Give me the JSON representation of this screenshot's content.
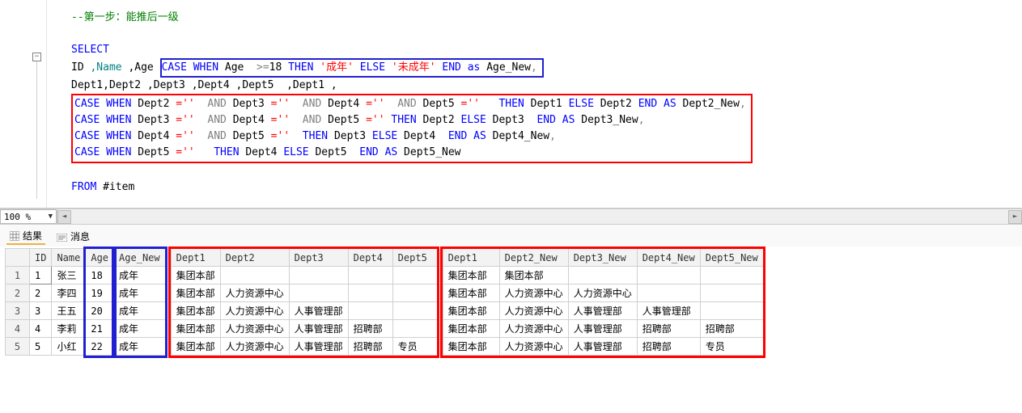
{
  "editor": {
    "comment_line": "--第一步：能推后一级",
    "blank": "",
    "select_kw": "SELECT",
    "line2_pre_id": "ID ",
    "line2_name": ",Name",
    "line2_age": " ,Age ",
    "case_age_case": "CASE",
    "case_age_when": " WHEN",
    "case_age_age": " Age ",
    "case_age_op": " >=",
    "case_age_18": "18 ",
    "case_age_then": "THEN",
    "case_age_adult": " '成年'",
    "case_age_else": " ELSE ",
    "case_age_minor": "'未成年'",
    "case_age_end": " END",
    "case_age_as": " as ",
    "case_age_alias": "Age_New",
    "case_age_comma": ",",
    "line3": "Dept1,Dept2 ,Dept3 ,Dept4 ,Dept5  ,Dept1 ,",
    "d2": {
      "p1": "CASE WHEN ",
      "p2": "Dept2 ",
      "p3": "='' ",
      "p4": " AND ",
      "p5": "Dept3 ",
      "p6": "='' ",
      "p7": " AND ",
      "p8": "Dept4 ",
      "p9": "='' ",
      "p10": " AND ",
      "p11": "Dept5 ",
      "p12": "=''  ",
      "p13": " THEN ",
      "p14": "Dept1 ",
      "p15": "ELSE",
      "p16": " Dept2 ",
      "p17": "END AS",
      "p18": " Dept2_New",
      "p19": ","
    },
    "d3": {
      "p1": "CASE WHEN ",
      "p2": "Dept3 ",
      "p3": "='' ",
      "p4": " AND ",
      "p5": "Dept4 ",
      "p6": "='' ",
      "p7": " AND ",
      "p8": "Dept5 ",
      "p9": "='' ",
      "p10": "THEN ",
      "p11": "Dept2 ",
      "p12": "ELSE",
      "p13": " Dept3  ",
      "p14": "END AS",
      "p15": " Dept3_New",
      "p16": ","
    },
    "d4": {
      "p1": "CASE WHEN ",
      "p2": "Dept4 ",
      "p3": "='' ",
      "p4": " AND ",
      "p5": "Dept5 ",
      "p6": "='' ",
      "p7": " THEN ",
      "p8": "Dept3 ",
      "p9": "ELSE",
      "p10": " Dept4  ",
      "p11": "END AS",
      "p12": " Dept4_New",
      "p13": ","
    },
    "d5": {
      "p1": "CASE WHEN ",
      "p2": "Dept5 ",
      "p3": "=''  ",
      "p4": " THEN ",
      "p5": "Dept4 ",
      "p6": "ELSE",
      "p7": " Dept5  ",
      "p8": "END AS",
      "p9": " Dept5_New"
    },
    "from_kw": "FROM",
    "from_tbl": " #item"
  },
  "zoom": {
    "value": "100 %"
  },
  "tabs": {
    "results": "结果",
    "messages": "消息"
  },
  "grid1": {
    "headers": [
      "ID",
      "Name",
      "Age",
      "Age_New"
    ],
    "rows": [
      {
        "n": "1",
        "ID": "1",
        "Name": "张三",
        "Age": "18",
        "Age_New": "成年"
      },
      {
        "n": "2",
        "ID": "2",
        "Name": "李四",
        "Age": "19",
        "Age_New": "成年"
      },
      {
        "n": "3",
        "ID": "3",
        "Name": "王五",
        "Age": "20",
        "Age_New": "成年"
      },
      {
        "n": "4",
        "ID": "4",
        "Name": "李莉",
        "Age": "21",
        "Age_New": "成年"
      },
      {
        "n": "5",
        "ID": "5",
        "Name": "小红",
        "Age": "22",
        "Age_New": "成年"
      }
    ]
  },
  "grid2": {
    "headers": [
      "Dept1",
      "Dept2",
      "Dept3",
      "Dept4",
      "Dept5"
    ],
    "rows": [
      {
        "Dept1": "集团本部",
        "Dept2": "",
        "Dept3": "",
        "Dept4": "",
        "Dept5": ""
      },
      {
        "Dept1": "集团本部",
        "Dept2": "人力资源中心",
        "Dept3": "",
        "Dept4": "",
        "Dept5": ""
      },
      {
        "Dept1": "集团本部",
        "Dept2": "人力资源中心",
        "Dept3": "人事管理部",
        "Dept4": "",
        "Dept5": ""
      },
      {
        "Dept1": "集团本部",
        "Dept2": "人力资源中心",
        "Dept3": "人事管理部",
        "Dept4": "招聘部",
        "Dept5": ""
      },
      {
        "Dept1": "集团本部",
        "Dept2": "人力资源中心",
        "Dept3": "人事管理部",
        "Dept4": "招聘部",
        "Dept5": "专员"
      }
    ]
  },
  "grid3": {
    "headers": [
      "Dept1",
      "Dept2_New",
      "Dept3_New",
      "Dept4_New",
      "Dept5_New"
    ],
    "rows": [
      {
        "Dept1": "集团本部",
        "Dept2_New": "集团本部",
        "Dept3_New": "",
        "Dept4_New": "",
        "Dept5_New": ""
      },
      {
        "Dept1": "集团本部",
        "Dept2_New": "人力资源中心",
        "Dept3_New": "人力资源中心",
        "Dept4_New": "",
        "Dept5_New": ""
      },
      {
        "Dept1": "集团本部",
        "Dept2_New": "人力资源中心",
        "Dept3_New": "人事管理部",
        "Dept4_New": "人事管理部",
        "Dept5_New": ""
      },
      {
        "Dept1": "集团本部",
        "Dept2_New": "人力资源中心",
        "Dept3_New": "人事管理部",
        "Dept4_New": "招聘部",
        "Dept5_New": "招聘部"
      },
      {
        "Dept1": "集团本部",
        "Dept2_New": "人力资源中心",
        "Dept3_New": "人事管理部",
        "Dept4_New": "招聘部",
        "Dept5_New": "专员"
      }
    ]
  }
}
